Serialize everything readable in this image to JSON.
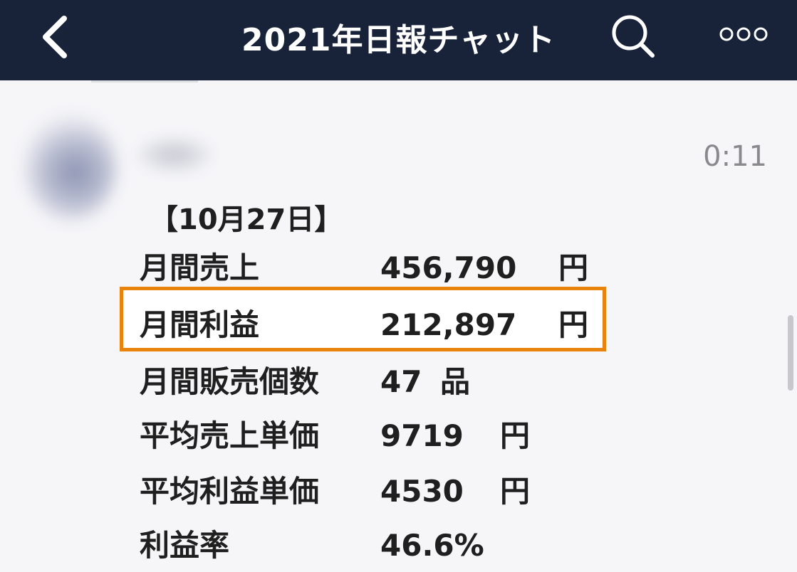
{
  "header": {
    "title": "2021年日報チャット",
    "back_icon": "chevron-left-icon",
    "search_icon": "search-icon",
    "more_icon": "more-dots-icon",
    "background": "#18233a"
  },
  "message": {
    "time": "0:11",
    "date": "【10月27日】",
    "rows": [
      {
        "label": "月間売上",
        "value": "456,790",
        "unit": "円"
      },
      {
        "label": "月間利益",
        "value": "212,897",
        "unit": "円",
        "highlighted": true
      },
      {
        "label": "月間販売個数",
        "value": "47",
        "unit": "品"
      },
      {
        "label": "平均売上単価",
        "value": "9719",
        "unit": "円"
      },
      {
        "label": "平均利益単価",
        "value": "4530",
        "unit": "円"
      },
      {
        "label": "利益率",
        "value": "46.6%",
        "unit": ""
      }
    ]
  },
  "colors": {
    "highlight_border": "#e8830b",
    "time_text": "#8a8a8e"
  }
}
